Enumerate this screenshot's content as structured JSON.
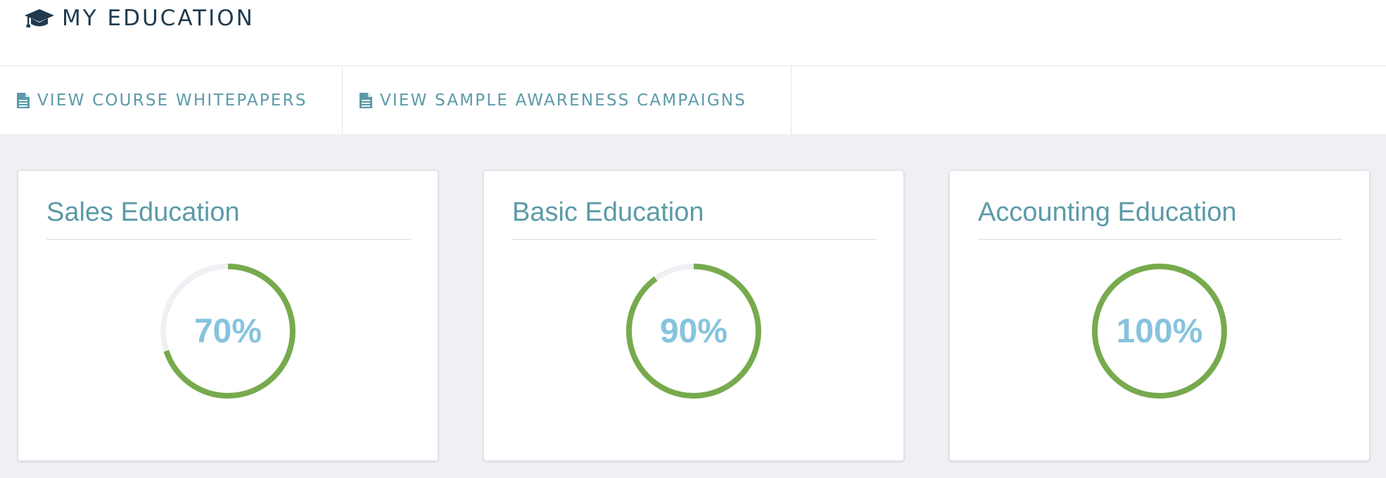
{
  "header": {
    "title": "MY EDUCATION",
    "icon": "graduation-cap-icon"
  },
  "tabs": [
    {
      "label": "VIEW COURSE WHITEPAPERS",
      "icon": "document-icon"
    },
    {
      "label": "VIEW SAMPLE AWARENESS CAMPAIGNS",
      "icon": "document-icon"
    }
  ],
  "cards": [
    {
      "title": "Sales Education",
      "percent_label": "70%",
      "progress": 0.7
    },
    {
      "title": "Basic Education",
      "percent_label": "90%",
      "progress": 0.9
    },
    {
      "title": "Accounting Education",
      "percent_label": "100%",
      "progress": 1.0
    }
  ],
  "colors": {
    "accent_teal": "#5b9aa8",
    "progress_green": "#77aa4d",
    "track_gray": "#eef0f4",
    "percent_blue": "#86c3de",
    "title_dark": "#1f3a4d"
  }
}
